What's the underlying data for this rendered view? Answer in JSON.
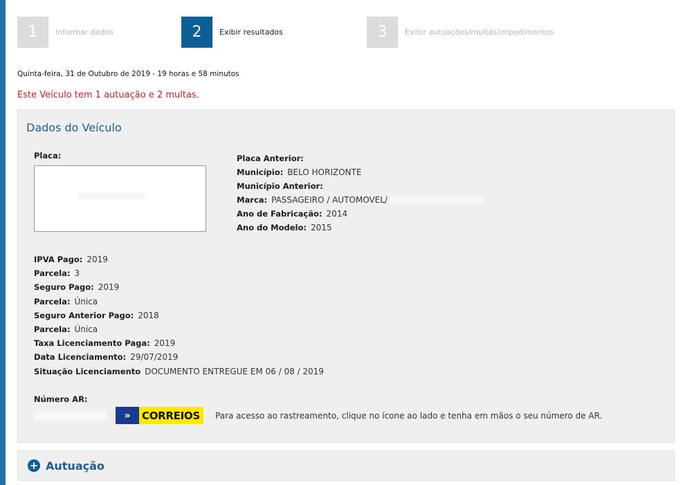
{
  "steps": [
    {
      "number": "1",
      "label": "Informar dados",
      "state": "inactive"
    },
    {
      "number": "2",
      "label": "Exibir resultados",
      "state": "active"
    },
    {
      "number": "3",
      "label": "Exibir autuações/multas/impedimentos",
      "state": "inactive"
    }
  ],
  "date_line": "Quinta-feira, 31 de Outubro de 2019 - 19 horas e 58 minutos",
  "alert": "Este Veículo tem 1 autuação e 2 multas.",
  "panel": {
    "title": "Dados do Veículo",
    "placa_label": "Placa:",
    "right": [
      {
        "label": "Placa Anterior:",
        "value": ""
      },
      {
        "label": "Município:",
        "value": "BELO HORIZONTE"
      },
      {
        "label": "Município Anterior:",
        "value": ""
      },
      {
        "label": "Marca:",
        "value": "PASSAGEIRO / AUTOMOVEL/"
      },
      {
        "label": "Ano de Fabricação:",
        "value": "2014"
      },
      {
        "label": "Ano do Modelo:",
        "value": "2015"
      }
    ],
    "details": [
      {
        "label": "IPVA Pago:",
        "value": "2019"
      },
      {
        "label": "Parcela:",
        "value": "3"
      },
      {
        "label": "Seguro Pago:",
        "value": "2019"
      },
      {
        "label": "Parcela:",
        "value": "Única"
      },
      {
        "label": "Seguro Anterior Pago:",
        "value": "2018"
      },
      {
        "label": "Parcela:",
        "value": "Única"
      },
      {
        "label": "Taxa Licenciamento Paga:",
        "value": "2019"
      },
      {
        "label": "Data Licenciamento:",
        "value": "29/07/2019"
      },
      {
        "label": "Situação Licenciamento",
        "value": "DOCUMENTO ENTREGUE EM 06 / 08 / 2019"
      }
    ],
    "numero_ar_label": "Número AR:",
    "correios_text": "CORREIOS",
    "ar_help": "Para acesso ao rastreamento, clique no ícone ao lado e tenha em mãos o seu número de AR."
  },
  "accordion": {
    "label": "Autuação",
    "icon": "plus-circle-icon"
  },
  "colors": {
    "accent": "#0b5f95",
    "alert": "#d41b1b",
    "title": "#1c5e94",
    "panel_bg": "#efefef"
  }
}
